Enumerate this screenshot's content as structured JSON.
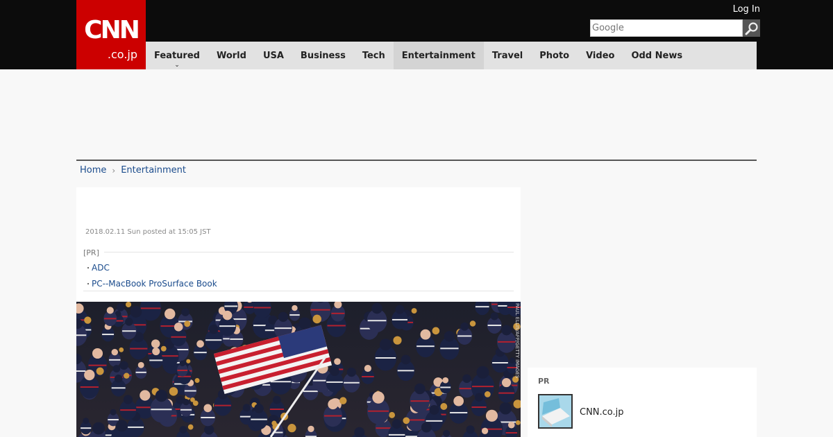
{
  "header": {
    "logo_main": "CNN",
    "logo_sub": ".co.jp",
    "login_label": "Log In",
    "search_placeholder": "Google"
  },
  "nav": {
    "items": [
      {
        "label": "Featured"
      },
      {
        "label": "World"
      },
      {
        "label": "USA"
      },
      {
        "label": "Business"
      },
      {
        "label": "Tech"
      },
      {
        "label": "Entertainment"
      },
      {
        "label": "Travel"
      },
      {
        "label": "Photo"
      },
      {
        "label": "Video"
      },
      {
        "label": "Odd News"
      }
    ],
    "active": "Entertainment"
  },
  "breadcrumb": {
    "home": "Home",
    "current": "Entertainment"
  },
  "article": {
    "posted": "2018.02.11 Sun posted at 15:05 JST",
    "pr_label": "[PR]",
    "pr_links": [
      {
        "label": "ADC"
      },
      {
        "label": "PC--MacBook ProSurface Book"
      }
    ],
    "photo_credit": "PAUL ELLIS/AFP/GETTY IMAGES"
  },
  "sidebar": {
    "pr_title": "PR",
    "pr_item_label": "CNN.co.jp"
  },
  "colors": {
    "brand_red": "#cc0000",
    "topbar": "#0c0c0c",
    "nav_bg": "#e2e2e2",
    "link": "#1a4b8c"
  }
}
